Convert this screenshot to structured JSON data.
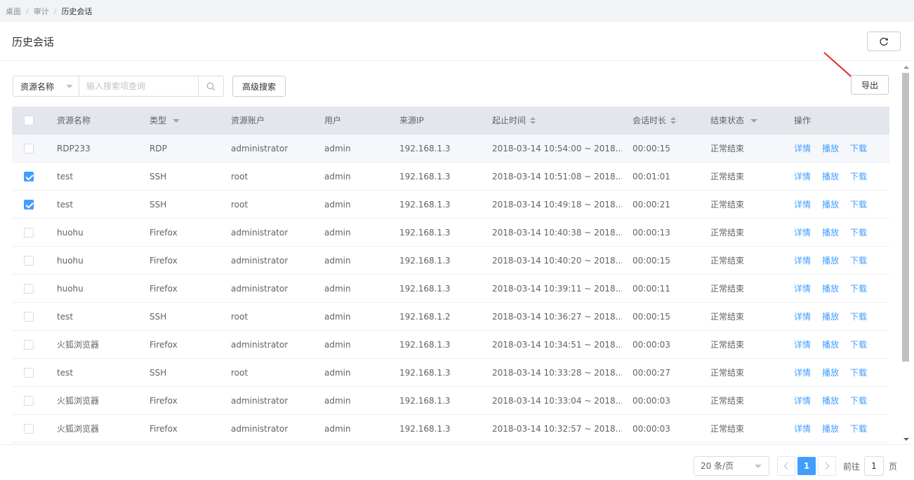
{
  "breadcrumb": [
    "桌面",
    "审计",
    "历史会话"
  ],
  "page_title": "历史会话",
  "toolbar": {
    "search_field": "资源名称",
    "search_placeholder": "输入搜索项查询",
    "advanced_search": "高级搜索",
    "export": "导出"
  },
  "columns": {
    "name": "资源名称",
    "type": "类型",
    "account": "资源账户",
    "user": "用户",
    "ip": "来源IP",
    "time": "起止时间",
    "duration": "会话时长",
    "status": "结束状态",
    "ops": "操作"
  },
  "actions": {
    "detail": "详情",
    "play": "播放",
    "download": "下载"
  },
  "rows": [
    {
      "checked": false,
      "name": "RDP233",
      "type": "RDP",
      "account": "administrator",
      "user": "admin",
      "ip": "192.168.1.3",
      "time": "2018-03-14 10:54:00 ~ 2018...",
      "duration": "00:00:15",
      "status": "正常结束"
    },
    {
      "checked": true,
      "name": "test",
      "type": "SSH",
      "account": "root",
      "user": "admin",
      "ip": "192.168.1.3",
      "time": "2018-03-14 10:51:08 ~ 2018...",
      "duration": "00:01:01",
      "status": "正常结束"
    },
    {
      "checked": true,
      "name": "test",
      "type": "SSH",
      "account": "root",
      "user": "admin",
      "ip": "192.168.1.3",
      "time": "2018-03-14 10:49:18 ~ 2018...",
      "duration": "00:00:21",
      "status": "正常结束"
    },
    {
      "checked": false,
      "name": "huohu",
      "type": "Firefox",
      "account": "administrator",
      "user": "admin",
      "ip": "192.168.1.3",
      "time": "2018-03-14 10:40:38 ~ 2018...",
      "duration": "00:00:13",
      "status": "正常结束"
    },
    {
      "checked": false,
      "name": "huohu",
      "type": "Firefox",
      "account": "administrator",
      "user": "admin",
      "ip": "192.168.1.3",
      "time": "2018-03-14 10:40:20 ~ 2018...",
      "duration": "00:00:15",
      "status": "正常结束"
    },
    {
      "checked": false,
      "name": "huohu",
      "type": "Firefox",
      "account": "administrator",
      "user": "admin",
      "ip": "192.168.1.3",
      "time": "2018-03-14 10:39:11 ~ 2018...",
      "duration": "00:00:11",
      "status": "正常结束"
    },
    {
      "checked": false,
      "name": "test",
      "type": "SSH",
      "account": "root",
      "user": "admin",
      "ip": "192.168.1.2",
      "time": "2018-03-14 10:36:27 ~ 2018...",
      "duration": "00:00:15",
      "status": "正常结束"
    },
    {
      "checked": false,
      "name": "火狐浏览器",
      "type": "Firefox",
      "account": "administrator",
      "user": "admin",
      "ip": "192.168.1.3",
      "time": "2018-03-14 10:34:51 ~ 2018...",
      "duration": "00:00:03",
      "status": "正常结束"
    },
    {
      "checked": false,
      "name": "test",
      "type": "SSH",
      "account": "root",
      "user": "admin",
      "ip": "192.168.1.3",
      "time": "2018-03-14 10:33:28 ~ 2018...",
      "duration": "00:00:27",
      "status": "正常结束"
    },
    {
      "checked": false,
      "name": "火狐浏览器",
      "type": "Firefox",
      "account": "administrator",
      "user": "admin",
      "ip": "192.168.1.3",
      "time": "2018-03-14 10:33:04 ~ 2018...",
      "duration": "00:00:03",
      "status": "正常结束"
    },
    {
      "checked": false,
      "name": "火狐浏览器",
      "type": "Firefox",
      "account": "administrator",
      "user": "admin",
      "ip": "192.168.1.3",
      "time": "2018-03-14 10:32:57 ~ 2018...",
      "duration": "00:00:03",
      "status": "正常结束"
    }
  ],
  "pagination": {
    "page_size": "20 条/页",
    "current_page": "1",
    "jump_label": "前往",
    "jump_value": "1",
    "jump_unit": "页"
  },
  "icons": [
    "refresh-icon",
    "search-icon",
    "chevron-left-icon",
    "chevron-right-icon",
    "arrow-annotation"
  ],
  "colors": {
    "primary": "#409eff",
    "annotation": "#e8242c",
    "header_bg": "#e3e6ec"
  }
}
